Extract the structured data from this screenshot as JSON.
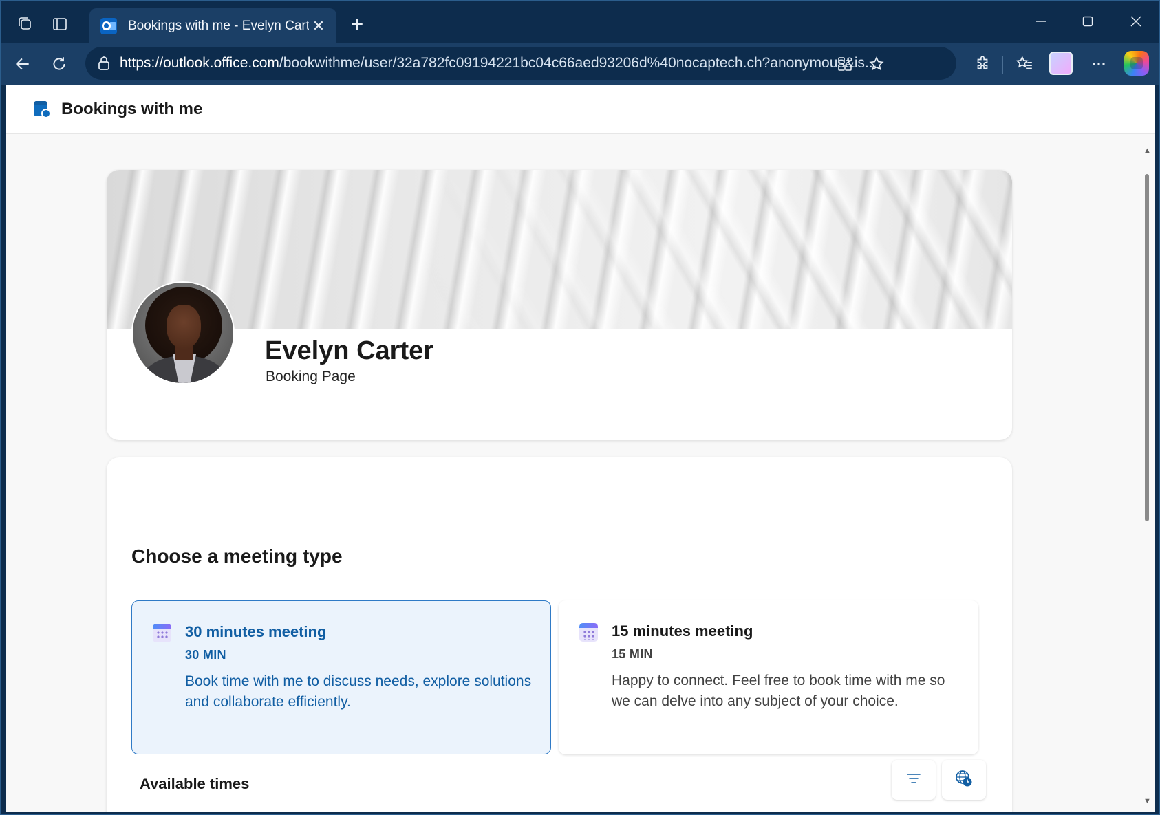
{
  "browser": {
    "tab": {
      "title": "Bookings with me - Evelyn Carter"
    },
    "address": {
      "url_host": "https://outlook.office.com",
      "url_path": "/bookwithme/user/32a782fc09194221bc04c66aed93206d%40nocaptech.ch?anonymous&is..."
    }
  },
  "app": {
    "title": "Bookings with me"
  },
  "profile": {
    "name": "Evelyn Carter",
    "subtitle": "Booking Page"
  },
  "meeting": {
    "section_title": "Choose a meeting type",
    "types": [
      {
        "title": "30 minutes meeting",
        "duration": "30 MIN",
        "description": "Book time with me to discuss needs, explore solutions and collaborate efficiently.",
        "selected": true
      },
      {
        "title": "15 minutes meeting",
        "duration": "15 MIN",
        "description": "Happy to connect. Feel free to book time with me so we can delve into any subject of your choice.",
        "selected": false
      }
    ],
    "available_times_label": "Available times"
  },
  "colors": {
    "accent": "#115ea3",
    "selected_bg": "#ebf3fc",
    "chrome": "#1b3f66"
  },
  "icons": {
    "workspaces": "workspaces-icon",
    "tab_actions": "tab-actions-icon",
    "back": "back-arrow-icon",
    "refresh": "refresh-icon",
    "filter": "filter-icon",
    "timezone": "globe-clock-icon"
  }
}
